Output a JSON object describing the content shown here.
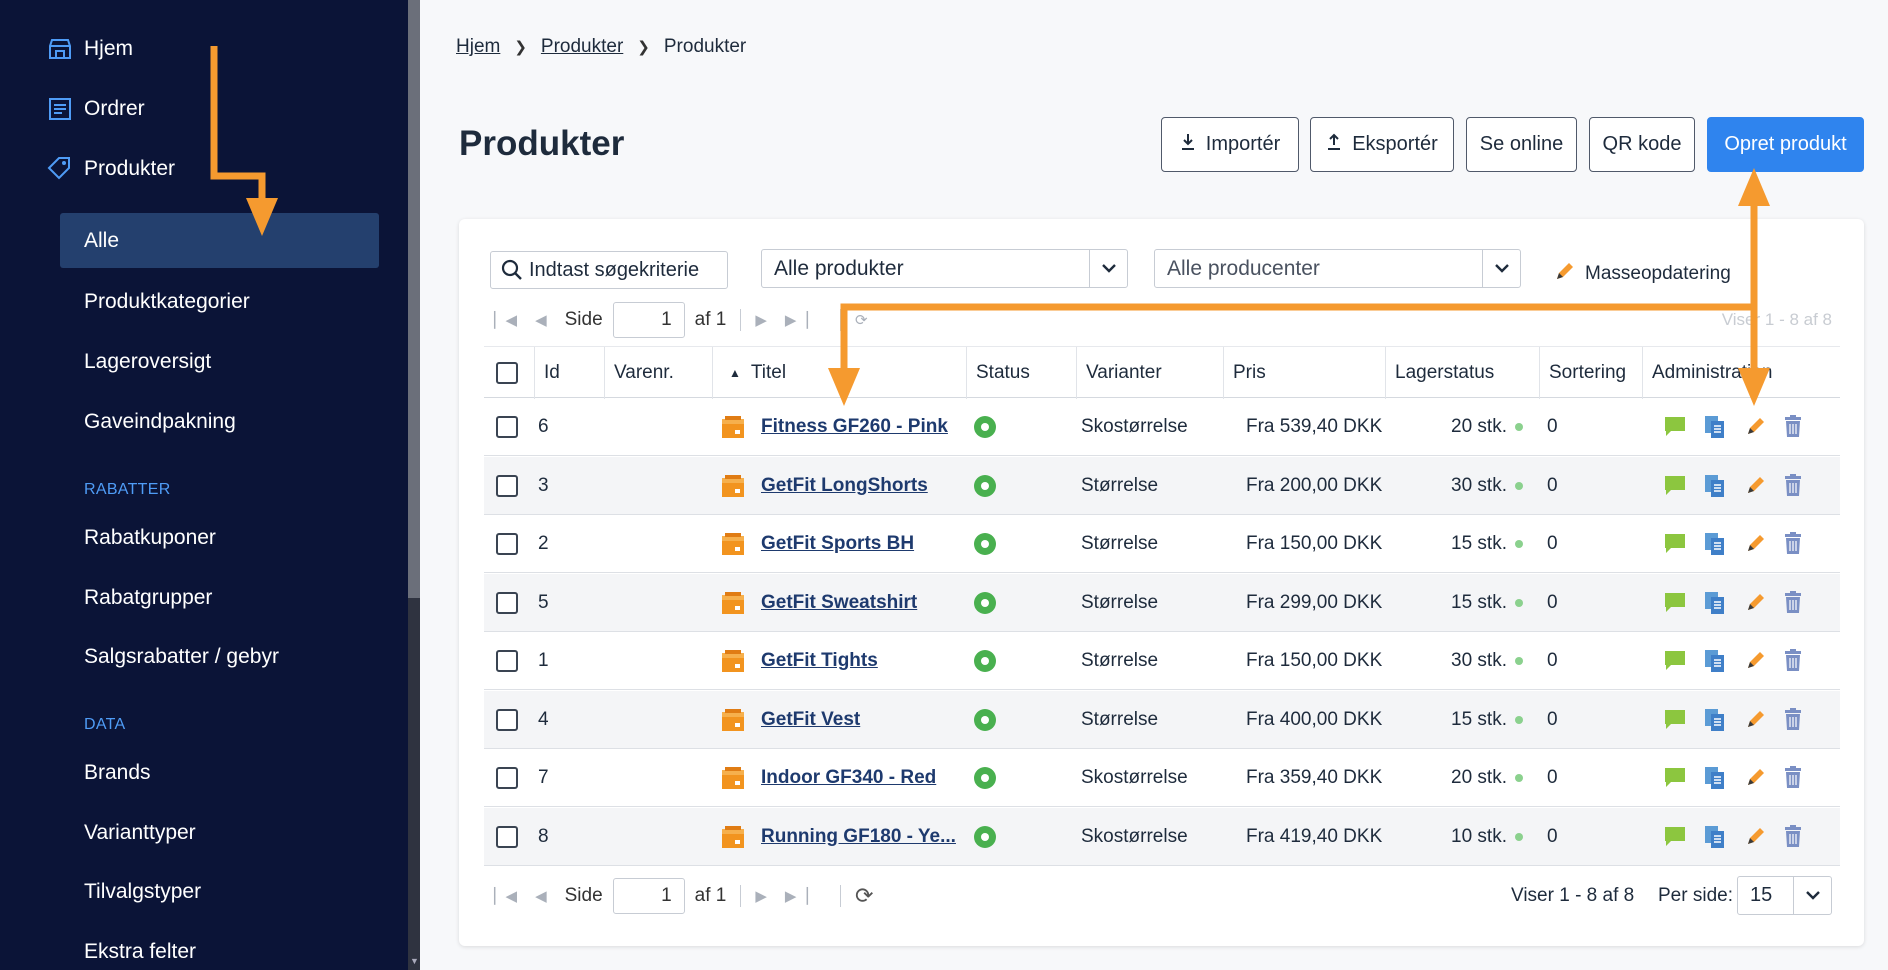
{
  "sidebar": {
    "items": [
      {
        "label": "Hjem",
        "icon": "store-icon"
      },
      {
        "label": "Ordrer",
        "icon": "list-icon"
      },
      {
        "label": "Produkter",
        "icon": "tag-icon"
      }
    ],
    "products_sub": [
      "Alle",
      "Produktkategorier",
      "Lageroversigt",
      "Gaveindpakning"
    ],
    "section_rabatter": "RABATTER",
    "rabatter": [
      "Rabatkuponer",
      "Rabatgrupper",
      "Salgsrabatter / gebyr"
    ],
    "section_data": "DATA",
    "data": [
      "Brands",
      "Varianttyper",
      "Tilvalgstyper",
      "Ekstra felter"
    ]
  },
  "breadcrumb": [
    "Hjem",
    "Produkter",
    "Produkter"
  ],
  "page_title": "Produkter",
  "buttons": {
    "import": "Importér",
    "export": "Eksportér",
    "online": "Se online",
    "qr": "QR kode",
    "create": "Opret produkt"
  },
  "filters": {
    "search": "Indtast søgekriterie",
    "products": "Alle produkter",
    "producers": "Alle producenter",
    "mass_update": "Masseopdatering"
  },
  "pager": {
    "side": "Side",
    "page": "1",
    "of": "af 1",
    "viser": "Viser 1 - 8 af 8",
    "per_side": "Per side:",
    "per_side_value": "15"
  },
  "columns": [
    "Id",
    "Varenr.",
    "Titel",
    "Status",
    "Varianter",
    "Pris",
    "Lagerstatus",
    "Sortering",
    "Administration"
  ],
  "rows": [
    {
      "id": "6",
      "title": "Fitness GF260 - Pink",
      "variant": "Skostørrelse",
      "price": "Fra 539,40 DKK",
      "stock": "20 stk.",
      "sort": "0"
    },
    {
      "id": "3",
      "title": "GetFit LongShorts",
      "variant": "Størrelse",
      "price": "Fra 200,00 DKK",
      "stock": "30 stk.",
      "sort": "0"
    },
    {
      "id": "2",
      "title": "GetFit Sports BH",
      "variant": "Størrelse",
      "price": "Fra 150,00 DKK",
      "stock": "15 stk.",
      "sort": "0"
    },
    {
      "id": "5",
      "title": "GetFit Sweatshirt",
      "variant": "Størrelse",
      "price": "Fra 299,00 DKK",
      "stock": "15 stk.",
      "sort": "0"
    },
    {
      "id": "1",
      "title": "GetFit Tights",
      "variant": "Størrelse",
      "price": "Fra 150,00 DKK",
      "stock": "30 stk.",
      "sort": "0"
    },
    {
      "id": "4",
      "title": "GetFit Vest",
      "variant": "Størrelse",
      "price": "Fra 400,00 DKK",
      "stock": "15 stk.",
      "sort": "0"
    },
    {
      "id": "7",
      "title": "Indoor GF340 - Red",
      "variant": "Skostørrelse",
      "price": "Fra 359,40 DKK",
      "stock": "20 stk.",
      "sort": "0"
    },
    {
      "id": "8",
      "title": "Running GF180 - Ye...",
      "variant": "Skostørrelse",
      "price": "Fra 419,40 DKK",
      "stock": "10 stk.",
      "sort": "0"
    }
  ],
  "colors": {
    "sidebar_bg": "#0b1437",
    "active_item": "#24406e",
    "primary": "#2f84ee",
    "arrow": "#f59a2f",
    "status_green": "#49b04f"
  }
}
